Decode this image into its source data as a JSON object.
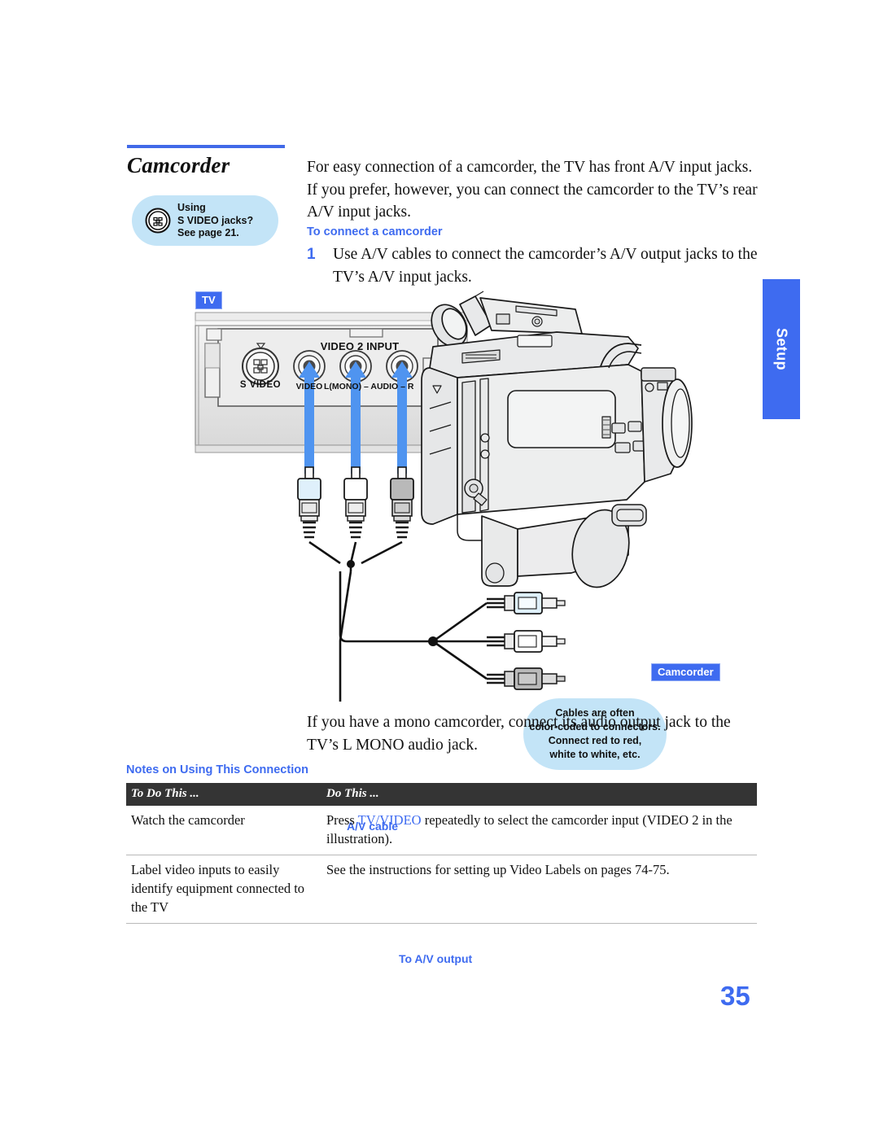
{
  "side_tab": {
    "label": "Setup"
  },
  "section": {
    "title": "Camcorder"
  },
  "callout": {
    "icon": "s-video-connector-icon",
    "line1": "Using",
    "line2": "S VIDEO jacks?",
    "line3": "See page 21."
  },
  "intro": "For easy connection of a camcorder, the TV has front A/V input jacks. If you prefer, however, you can connect the camcorder to the TV’s rear A/V input jacks.",
  "subhead": "To connect a camcorder",
  "step": {
    "number": "1",
    "text": "Use A/V cables to connect the camcorder’s A/V output jacks to the TV’s A/V input jacks."
  },
  "figure": {
    "tv_badge": "TV",
    "camcorder_badge": "Camcorder",
    "bubble": {
      "line1": "Cables are often",
      "line2": "color-coded to connectors.",
      "line3": "Connect red to red,",
      "line4": "white to white, etc."
    },
    "av_cable_label": "A/V cable",
    "av_output_label": "To A/V output",
    "panel": {
      "s_video_label": "S VIDEO",
      "video2_input_label": "VIDEO 2 INPUT",
      "video_jack_label": "VIDEO",
      "audio_jacks_label": "L(MONO) – AUDIO – R"
    }
  },
  "mono_note": "If you have a mono camcorder, connect its audio output jack to the TV’s L MONO audio jack.",
  "notes": {
    "heading": "Notes on Using This Connection",
    "columns": [
      "To Do This ...",
      "Do This ..."
    ],
    "rows": [
      {
        "do_this": "Watch the camcorder",
        "action_pre": "Press ",
        "action_key": "TV/VIDEO",
        "action_post": " repeatedly to select the camcorder input (VIDEO 2 in the illustration)."
      },
      {
        "do_this": "Label video inputs to easily identify equipment connected to the TV",
        "action_pre": "See the instructions for setting up Video Labels on pages 74-75.",
        "action_key": "",
        "action_post": ""
      }
    ]
  },
  "page_number": "35",
  "colors": {
    "accent_blue": "#3e6bf0",
    "callout_blue": "#c3e4f7",
    "table_header": "#343434",
    "arrow_blue": "#4f94f0"
  }
}
